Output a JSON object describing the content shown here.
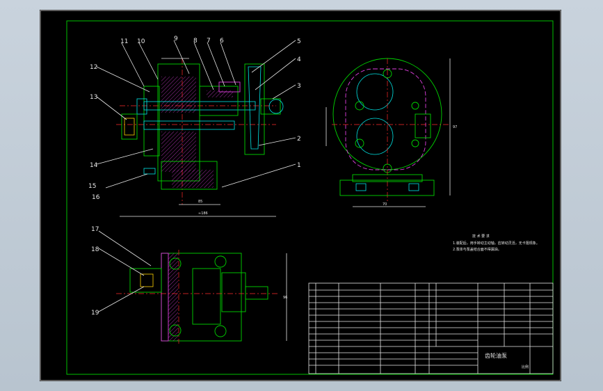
{
  "drawing": {
    "title_block": {
      "drawing_name": "齿轮油泵",
      "scale_label": "比例"
    },
    "tech_requirements": {
      "heading": "技 术 要 求",
      "lines": [
        "1.装配后，用手转动主动轴，应转动灵活，无卡阻现象。",
        "2.泵体与泵盖结合面不得漏油。"
      ]
    },
    "balloons": [
      "1",
      "2",
      "3",
      "4",
      "5",
      "6",
      "7",
      "8",
      "9",
      "10",
      "11",
      "12",
      "13",
      "14",
      "15",
      "16",
      "17",
      "18",
      "19"
    ],
    "dimensions": {
      "overall_length": "≈186",
      "base_width": "70",
      "left_span": "85",
      "height_right": "97",
      "height_plan": "96"
    }
  },
  "colors": {
    "frame": "#00d400",
    "section_lines": "#00e5e5",
    "centerlines": "#ff2a2a",
    "highlight": "#e040e0",
    "text": "#e8e8e8"
  }
}
